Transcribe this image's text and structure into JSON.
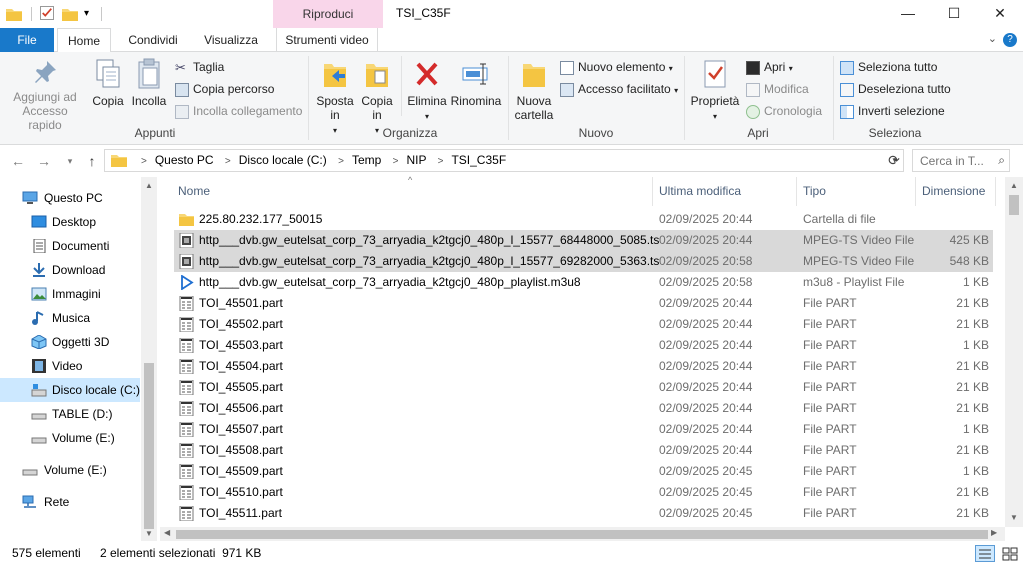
{
  "window": {
    "title": "TSI_C35F",
    "context_tab": "Riproduci",
    "min": "—",
    "max": "☐",
    "close": "✕"
  },
  "tabs": {
    "file": "File",
    "home": "Home",
    "share": "Condividi",
    "view": "Visualizza",
    "video": "Strumenti video"
  },
  "ribbon": {
    "clipboard": {
      "pin": "Aggiungi ad Accesso rapido",
      "copy": "Copia",
      "paste": "Incolla",
      "cut": "Taglia",
      "copy_path": "Copia percorso",
      "paste_shortcut": "Incolla collegamento",
      "label": "Appunti"
    },
    "organize": {
      "move_to": "Sposta in",
      "copy_to": "Copia in",
      "delete": "Elimina",
      "rename": "Rinomina",
      "label": "Organizza"
    },
    "new": {
      "new_folder": "Nuova cartella",
      "new_item": "Nuovo elemento",
      "easy_access": "Accesso facilitato",
      "label": "Nuovo"
    },
    "open": {
      "properties": "Proprietà",
      "open": "Apri",
      "edit": "Modifica",
      "history": "Cronologia",
      "label": "Apri"
    },
    "select": {
      "select_all": "Seleziona tutto",
      "select_none": "Deseleziona tutto",
      "invert": "Inverti selezione",
      "label": "Seleziona"
    }
  },
  "address": {
    "crumbs": [
      "Questo PC",
      "Disco locale (C:)",
      "Temp",
      "NIP",
      "TSI_C35F"
    ],
    "search_placeholder": "Cerca in T..."
  },
  "nav": [
    {
      "label": "Questo PC",
      "icon": "pc-icon"
    },
    {
      "label": "Desktop",
      "icon": "desktop-icon"
    },
    {
      "label": "Documenti",
      "icon": "documents-icon"
    },
    {
      "label": "Download",
      "icon": "download-icon"
    },
    {
      "label": "Immagini",
      "icon": "pictures-icon"
    },
    {
      "label": "Musica",
      "icon": "music-icon"
    },
    {
      "label": "Oggetti 3D",
      "icon": "objects3d-icon"
    },
    {
      "label": "Video",
      "icon": "video-icon"
    },
    {
      "label": "Disco locale (C:)",
      "icon": "drive-icon"
    },
    {
      "label": "TABLE (D:)",
      "icon": "drive-icon"
    },
    {
      "label": "Volume (E:)",
      "icon": "drive-icon"
    },
    {
      "label": "Volume (E:)",
      "icon": "drive-icon"
    },
    {
      "label": "Rete",
      "icon": "network-icon"
    }
  ],
  "columns": {
    "name": "Nome",
    "date": "Ultima modifica",
    "type": "Tipo",
    "size": "Dimensione"
  },
  "files": [
    {
      "name": "225.80.232.177_50015",
      "date": "02/09/2025 20:44",
      "type": "Cartella di file",
      "size": "",
      "icon": "folder-icon",
      "selected": false
    },
    {
      "name": "http___dvb.gw_eutelsat_corp_73_arryadia_k2tgcj0_480p_l_15577_68448000_5085.ts",
      "date": "02/09/2025 20:44",
      "type": "MPEG-TS Video File",
      "size": "425 KB",
      "icon": "video-file-icon",
      "selected": true
    },
    {
      "name": "http___dvb.gw_eutelsat_corp_73_arryadia_k2tgcj0_480p_l_15577_69282000_5363.ts",
      "date": "02/09/2025 20:58",
      "type": "MPEG-TS Video File",
      "size": "548 KB",
      "icon": "video-file-icon",
      "selected": true
    },
    {
      "name": "http___dvb.gw_eutelsat_corp_73_arryadia_k2tgcj0_480p_playlist.m3u8",
      "date": "02/09/2025 20:58",
      "type": "m3u8 - Playlist File",
      "size": "1 KB",
      "icon": "play-icon",
      "selected": false
    },
    {
      "name": "TOI_45501.part",
      "date": "02/09/2025 20:44",
      "type": "File PART",
      "size": "21 KB",
      "icon": "part-file-icon",
      "selected": false
    },
    {
      "name": "TOI_45502.part",
      "date": "02/09/2025 20:44",
      "type": "File PART",
      "size": "21 KB",
      "icon": "part-file-icon",
      "selected": false
    },
    {
      "name": "TOI_45503.part",
      "date": "02/09/2025 20:44",
      "type": "File PART",
      "size": "1 KB",
      "icon": "part-file-icon",
      "selected": false
    },
    {
      "name": "TOI_45504.part",
      "date": "02/09/2025 20:44",
      "type": "File PART",
      "size": "21 KB",
      "icon": "part-file-icon",
      "selected": false
    },
    {
      "name": "TOI_45505.part",
      "date": "02/09/2025 20:44",
      "type": "File PART",
      "size": "21 KB",
      "icon": "part-file-icon",
      "selected": false
    },
    {
      "name": "TOI_45506.part",
      "date": "02/09/2025 20:44",
      "type": "File PART",
      "size": "21 KB",
      "icon": "part-file-icon",
      "selected": false
    },
    {
      "name": "TOI_45507.part",
      "date": "02/09/2025 20:44",
      "type": "File PART",
      "size": "1 KB",
      "icon": "part-file-icon",
      "selected": false
    },
    {
      "name": "TOI_45508.part",
      "date": "02/09/2025 20:44",
      "type": "File PART",
      "size": "21 KB",
      "icon": "part-file-icon",
      "selected": false
    },
    {
      "name": "TOI_45509.part",
      "date": "02/09/2025 20:45",
      "type": "File PART",
      "size": "1 KB",
      "icon": "part-file-icon",
      "selected": false
    },
    {
      "name": "TOI_45510.part",
      "date": "02/09/2025 20:45",
      "type": "File PART",
      "size": "21 KB",
      "icon": "part-file-icon",
      "selected": false
    },
    {
      "name": "TOI_45511.part",
      "date": "02/09/2025 20:45",
      "type": "File PART",
      "size": "21 KB",
      "icon": "part-file-icon",
      "selected": false
    }
  ],
  "status": {
    "count": "575 elementi",
    "selection": "2 elementi selezionati  971 KB"
  },
  "colors": {
    "accent": "#1979ca",
    "selection": "#d9d9d9",
    "nav_selection": "#cce8ff",
    "context_tab": "#f9d6ea"
  }
}
